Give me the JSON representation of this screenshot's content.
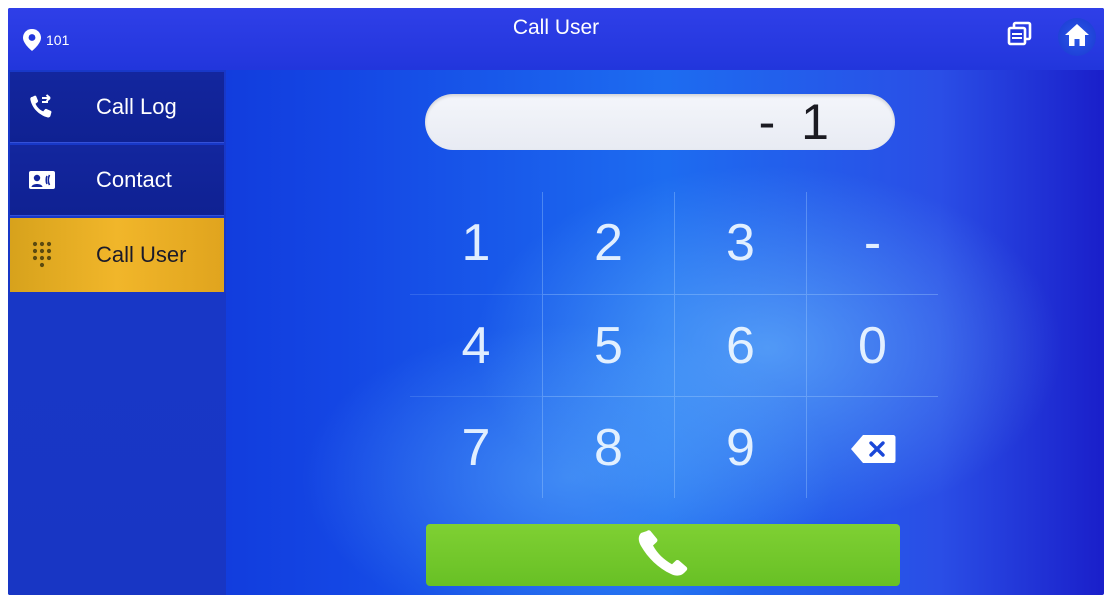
{
  "header": {
    "location_number": "101",
    "title": "Call User",
    "multi_screen_icon": "multi-window-icon",
    "home_icon": "home-icon"
  },
  "sidebar": {
    "items": [
      {
        "label": "Call Log",
        "icon": "call-log-icon",
        "active": false
      },
      {
        "label": "Contact",
        "icon": "contact-card-icon",
        "active": false
      },
      {
        "label": "Call User",
        "icon": "dialpad-icon",
        "active": true
      }
    ]
  },
  "dial": {
    "input_value": "- 1"
  },
  "keypad": {
    "keys": [
      "1",
      "2",
      "3",
      "-",
      "4",
      "5",
      "6",
      "0",
      "7",
      "8",
      "9"
    ],
    "delete_icon": "backspace-icon"
  },
  "call_button": {
    "icon": "phone-icon",
    "color": "#76c82d"
  },
  "colors": {
    "active_tab": "#f1b62a",
    "background": "#1d6cf0"
  }
}
